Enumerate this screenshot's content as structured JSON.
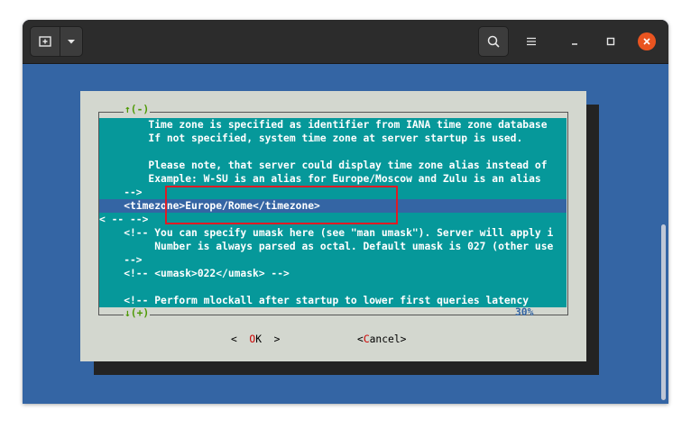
{
  "titlebar": {
    "new_tab_icon": "new-tab-icon",
    "dropdown_icon": "chevron-down-icon",
    "search_icon": "search-icon",
    "menu_icon": "hamburger-menu-icon",
    "minimize_icon": "minimize-icon",
    "maximize_icon": "maximize-icon",
    "close_icon": "close-icon"
  },
  "dialog": {
    "top_label": "↑(-)",
    "bottom_label": "↓(+)",
    "scroll_percent": "30%",
    "lines": [
      "        Time zone is specified as identifier from IANA time zone database",
      "        If not specified, system time zone at server startup is used.",
      "",
      "        Please note, that server could display time zone alias instead of",
      "        Example: W-SU is an alias for Europe/Moscow and Zulu is an alias",
      "    -->",
      "    <timezone>Europe/Rome</timezone>",
      "< -- -->",
      "    <!-- You can specify umask here (see \"man umask\"). Server will apply i",
      "         Number is always parsed as octal. Default umask is 027 (other use",
      "    -->",
      "    <!-- <umask>022</umask> -->",
      "",
      "    <!-- Perform mlockall after startup to lower first queries latency"
    ],
    "selected_line_index": 6,
    "ok_left": "<  ",
    "ok_hot": "O",
    "ok_rest": "K",
    "ok_right": "  >",
    "cancel_left": "<",
    "cancel_hot": "C",
    "cancel_rest": "ancel>"
  },
  "colors": {
    "terminal_bg": "#3465a4",
    "dialog_bg": "#d3d7cf",
    "textbox_bg": "#06989a",
    "selection_bg": "#3465a4",
    "highlight_border": "#e01b24",
    "close_button": "#e95420"
  }
}
